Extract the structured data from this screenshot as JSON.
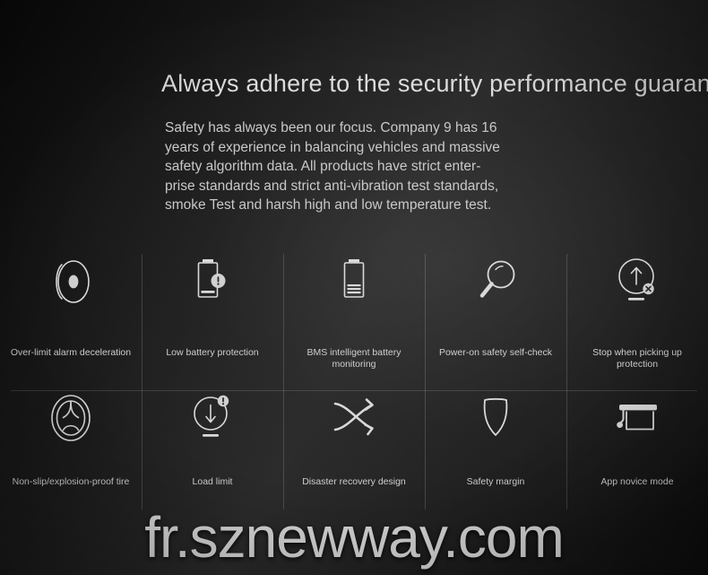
{
  "header": {
    "headline": "Always adhere to the security performance guarantee",
    "paragraph_lines": [
      "Safety has always been our focus. Company 9 has 16",
      "years of experience in balancing vehicles and massive",
      "safety algorithm data. All products have strict enter-",
      "prise standards and strict anti-vibration test standards,",
      "smoke Test and harsh high and low temperature test."
    ]
  },
  "features": {
    "row1": [
      {
        "label": "Over-limit alarm deceleration",
        "icon": "alarm-siren-icon"
      },
      {
        "label": "Low battery protection",
        "icon": "battery-warning-icon"
      },
      {
        "label": "BMS intelligent battery monitoring",
        "icon": "battery-level-icon"
      },
      {
        "label": "Power-on safety self-check",
        "icon": "magnifier-icon"
      },
      {
        "label": "Stop when picking up protection",
        "icon": "lift-stop-icon"
      }
    ],
    "row2": [
      {
        "label": "Non-slip/explosion-proof tire",
        "icon": "tire-icon"
      },
      {
        "label": "Load limit",
        "icon": "load-limit-icon"
      },
      {
        "label": "Disaster recovery design",
        "icon": "shuffle-arrows-icon"
      },
      {
        "label": "Safety margin",
        "icon": "shield-icon"
      },
      {
        "label": "App novice mode",
        "icon": "graduation-cap-icon"
      }
    ]
  },
  "watermark": {
    "text": "fr.sznewway.com"
  },
  "colors": {
    "background_dark": "#0a0a0a",
    "background_mid": "#2b2b2b",
    "headline_text": "#dcdcdc",
    "body_text": "#c9c9c9",
    "caption_text": "#cfcfcf",
    "icon_stroke": "#d9d9d9",
    "divider": "rgba(255,255,255,0.16)",
    "watermark_text": "#d6d6d6"
  }
}
